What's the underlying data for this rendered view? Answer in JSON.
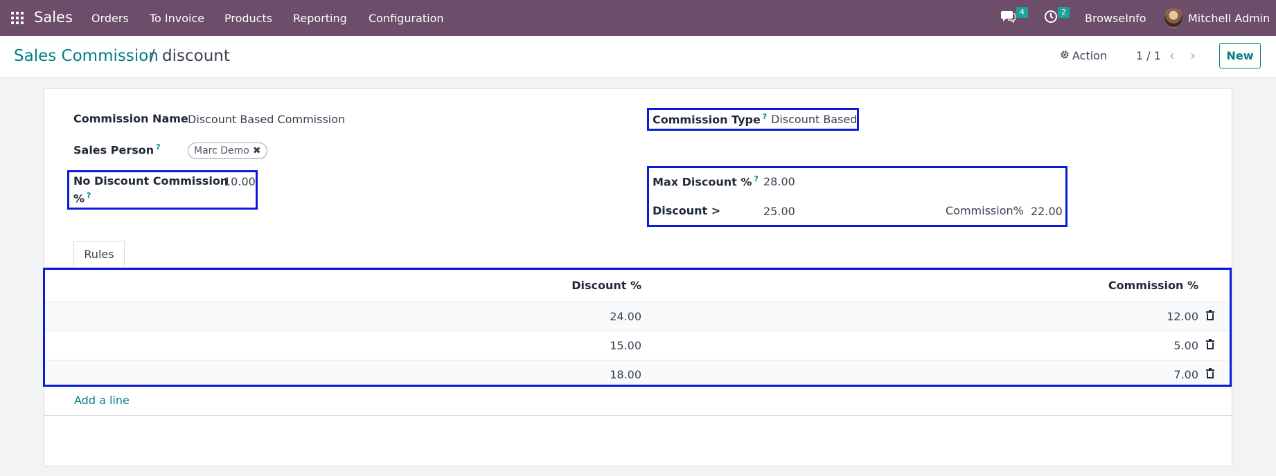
{
  "navbar": {
    "app_name": "Sales",
    "menu": [
      "Orders",
      "To Invoice",
      "Products",
      "Reporting",
      "Configuration"
    ],
    "messages_count": "4",
    "activities_count": "2",
    "company": "BrowseInfo",
    "user": "Mitchell Admin",
    "bg_color": "#6c4d6a"
  },
  "breadcrumb": {
    "parent": "Sales Commission",
    "separator": "/",
    "current": "discount"
  },
  "controls": {
    "action_label": "Action",
    "pager": "1 / 1",
    "new_label": "New"
  },
  "form": {
    "commission_name_label": "Commission Name",
    "commission_name_value": "Discount Based Commission",
    "sales_person_label": "Sales Person",
    "sales_person_tag": "Marc Demo",
    "no_discount_label_1": "No Discount Commission",
    "no_discount_label_2": "%",
    "no_discount_value": "10.00",
    "commission_type_label": "Commission Type",
    "commission_type_value": "Discount Based",
    "max_discount_label": "Max Discount %",
    "max_discount_value": "28.00",
    "discount_gt_label": "Discount >",
    "discount_gt_value": "25.00",
    "commission_pct_label": "Commission%",
    "commission_pct_value": "22.00",
    "help_mark": "?"
  },
  "tabs": [
    {
      "label": "Rules"
    }
  ],
  "rules_table": {
    "headers": [
      "Discount %",
      "Commission %"
    ],
    "rows": [
      {
        "discount": "24.00",
        "commission": "12.00"
      },
      {
        "discount": "15.00",
        "commission": "5.00"
      },
      {
        "discount": "18.00",
        "commission": "7.00"
      }
    ],
    "add_line_label": "Add a line"
  },
  "colors": {
    "accent": "#017e84",
    "highlight": "#0a1adb"
  }
}
